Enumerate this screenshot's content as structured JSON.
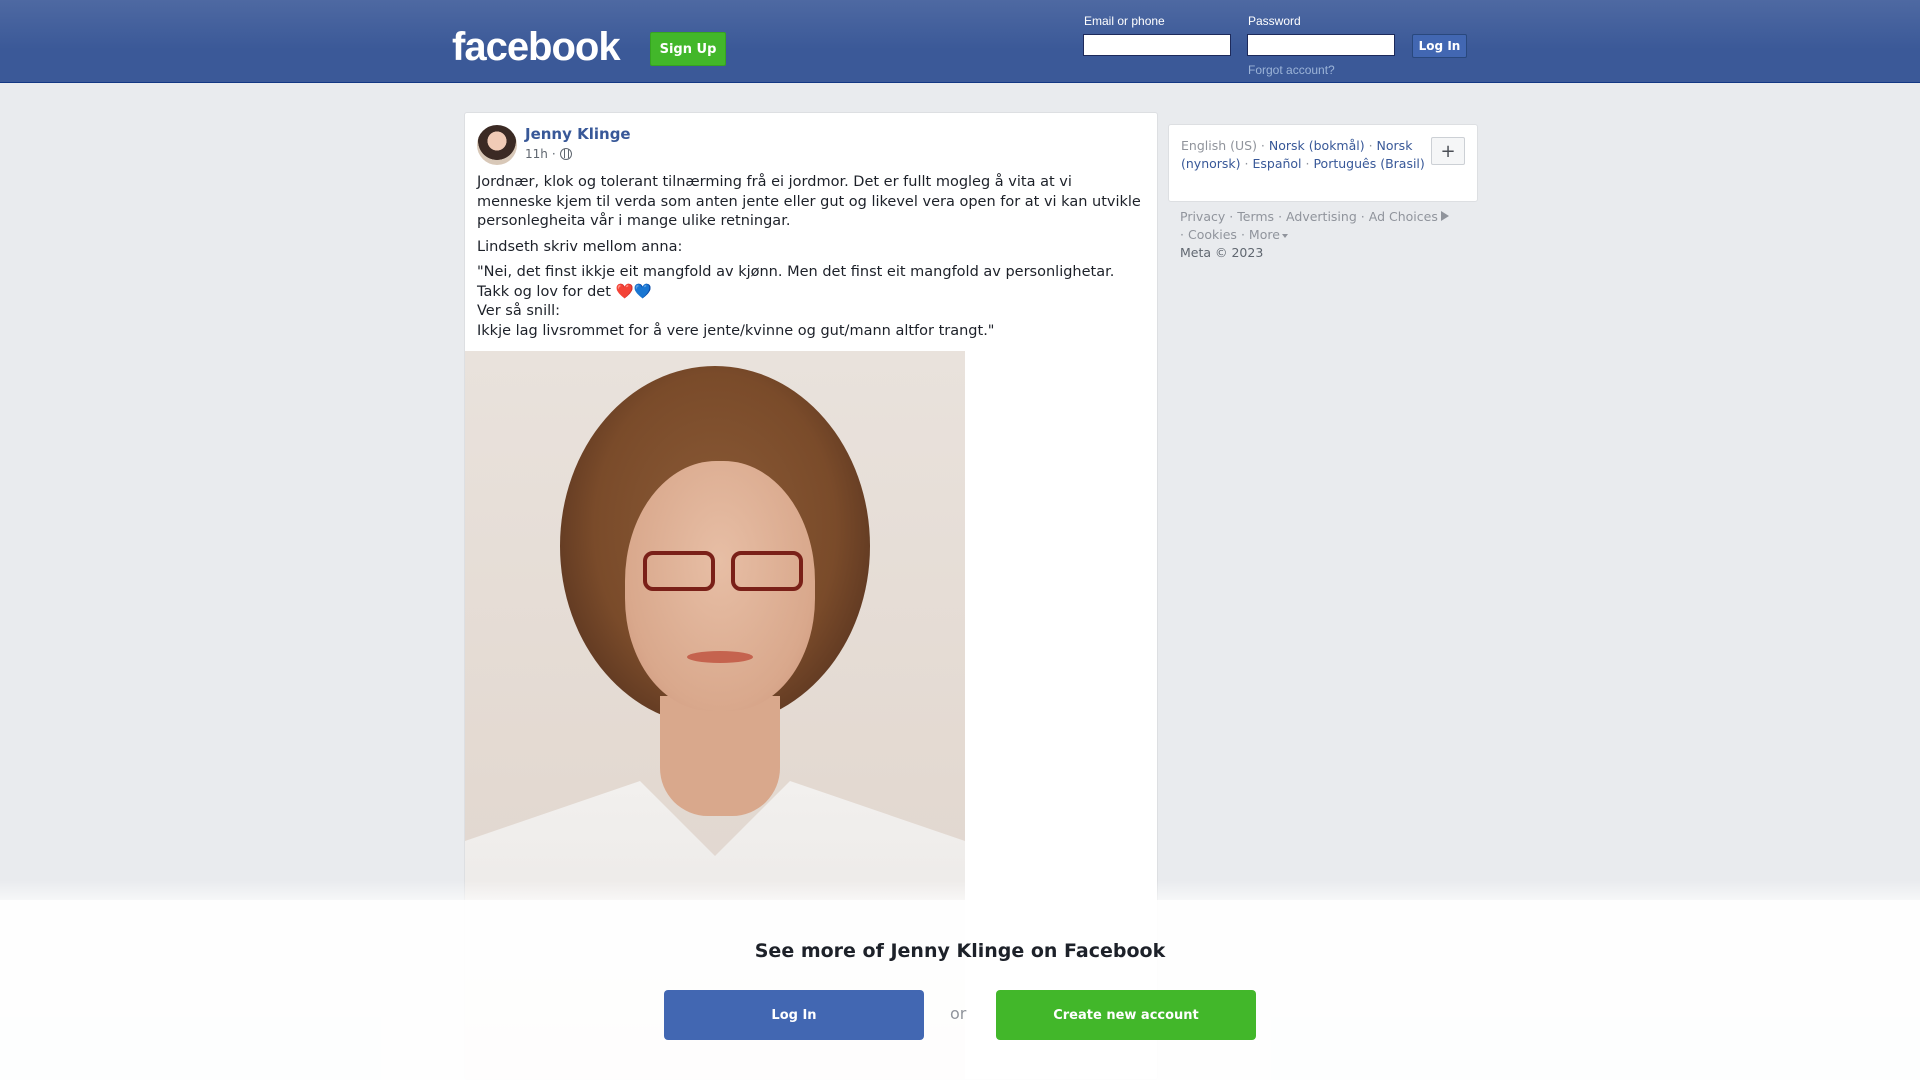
{
  "header": {
    "logo": "facebook",
    "signup_label": "Sign Up",
    "email_label": "Email or phone",
    "password_label": "Password",
    "login_label": "Log In",
    "forgot_label": "Forgot account?"
  },
  "post": {
    "author": "Jenny Klinge",
    "time": "11h",
    "visibility_icon": "globe-icon",
    "paragraph1": "Jordnær, klok og tolerant tilnærming frå ei jordmor. Det er fullt mogleg å vita at vi menneske kjem til verda som anten jente eller gut og likevel vera open for at vi kan utvikle personlegheita vår i mange ulike retningar.",
    "paragraph2": "Lindseth skriv mellom anna:",
    "quote_line1": "\"Nei, det finst ikkje eit mangfold av kjønn. Men det finst eit mangfold av personlighetar. Takk og lov for det ",
    "heart1": "❤️",
    "heart2": "💙",
    "quote_line2": "Ver så snill:",
    "quote_line3": "Ikkje lag livsrommet for å vere jente/kvinne og gut/mann altfor trangt.\""
  },
  "languages": {
    "current": "English (US)",
    "links": [
      "Norsk (bokmål)",
      "Norsk (nynorsk)",
      "Español",
      "Português (Brasil)"
    ],
    "more_button": "+"
  },
  "footer": {
    "links": [
      "Privacy",
      "Terms",
      "Advertising",
      "Ad Choices",
      "Cookies",
      "More"
    ],
    "copyright": "Meta © 2023"
  },
  "overlay": {
    "title": "See more of Jenny Klinge on Facebook",
    "login_label": "Log In",
    "or_label": "or",
    "create_label": "Create new account"
  },
  "colors": {
    "brand_blue": "#3b5998",
    "button_blue": "#4267b2",
    "green": "#42b72a",
    "link": "#385898"
  }
}
